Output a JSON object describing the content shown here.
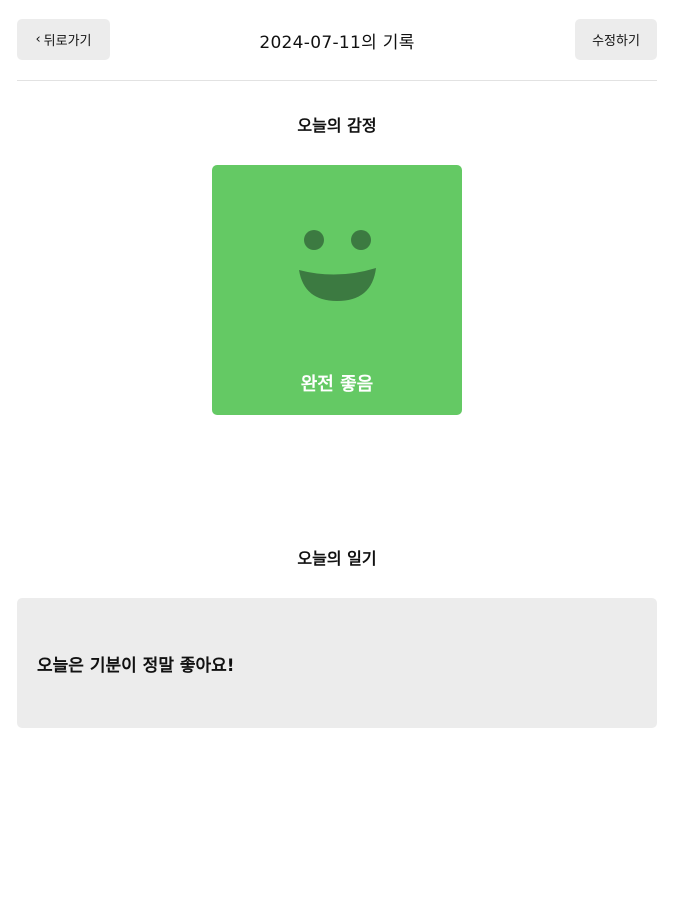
{
  "header": {
    "back_label": "뒤로가기",
    "title": "2024-07-11의 기록",
    "edit_label": "수정하기"
  },
  "emotion_section": {
    "title": "오늘의 감정",
    "label": "완전 좋음",
    "icon": "big-smile-icon",
    "card_color": "#64c964",
    "face_color": "#3c7a41"
  },
  "diary_section": {
    "title": "오늘의 일기",
    "content": "오늘은 기분이 정말 좋아요!"
  }
}
